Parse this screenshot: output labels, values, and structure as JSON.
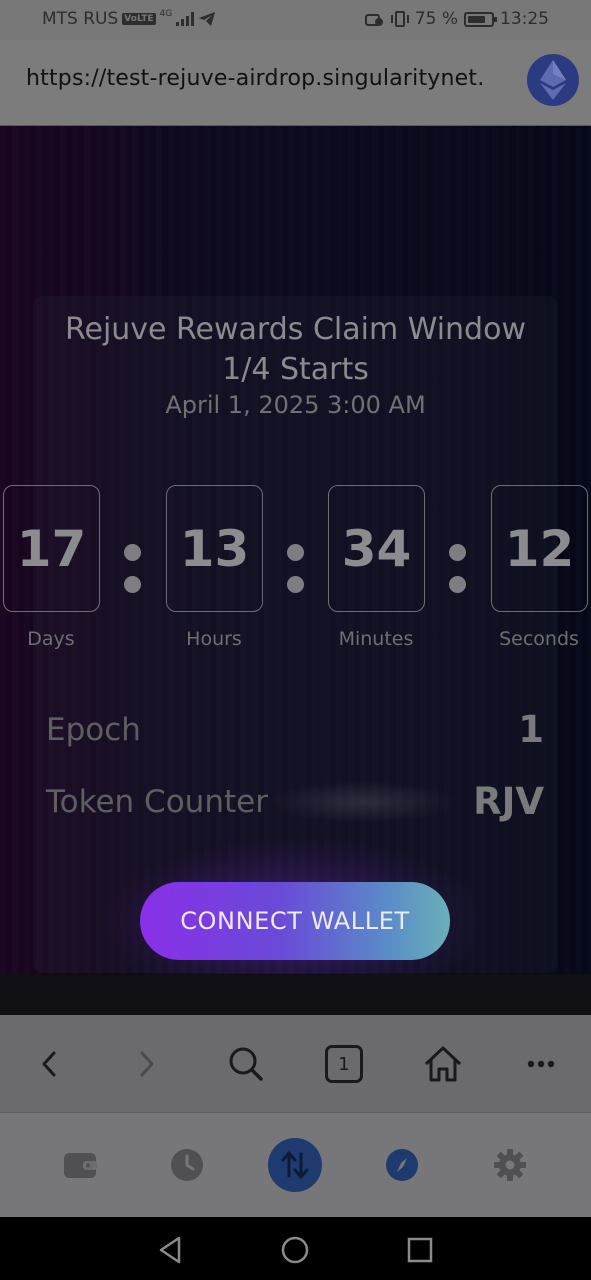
{
  "status_bar": {
    "carrier": "MTS RUS",
    "volte": "VoLTE",
    "network": "4G",
    "battery_percent": "75 %",
    "battery_level": 0.75,
    "time": "13:25"
  },
  "browser": {
    "url": "https://test-rejuve-airdrop.singularitynet.io",
    "tab_count": "1"
  },
  "claim": {
    "title_line1": "Rejuve Rewards Claim Window",
    "title_line2": "1/4 Starts",
    "date": "April 1, 2025 3:00 AM"
  },
  "countdown": {
    "days": "17",
    "days_label": "Days",
    "hours": "13",
    "hours_label": "Hours",
    "minutes": "34",
    "minutes_label": "Minutes",
    "seconds": "12",
    "seconds_label": "Seconds"
  },
  "info": {
    "epoch_label": "Epoch",
    "epoch_value": "1",
    "token_label": "Token Counter",
    "token_value": "RJV"
  },
  "connect_button": "CONNECT WALLET",
  "colors": {
    "button_start": "#8a2fe8",
    "button_end": "#6ab0b8",
    "wallet_active": "#1e3a6e"
  },
  "icons": {
    "eth": "ethereum-icon",
    "back": "chevron-left-icon",
    "forward": "chevron-right-icon",
    "search": "search-icon",
    "home": "home-icon",
    "more": "more-icon",
    "wallet": "wallet-icon",
    "history": "clock-icon",
    "swap": "swap-icon",
    "discover": "compass-icon",
    "settings": "gear-icon"
  }
}
